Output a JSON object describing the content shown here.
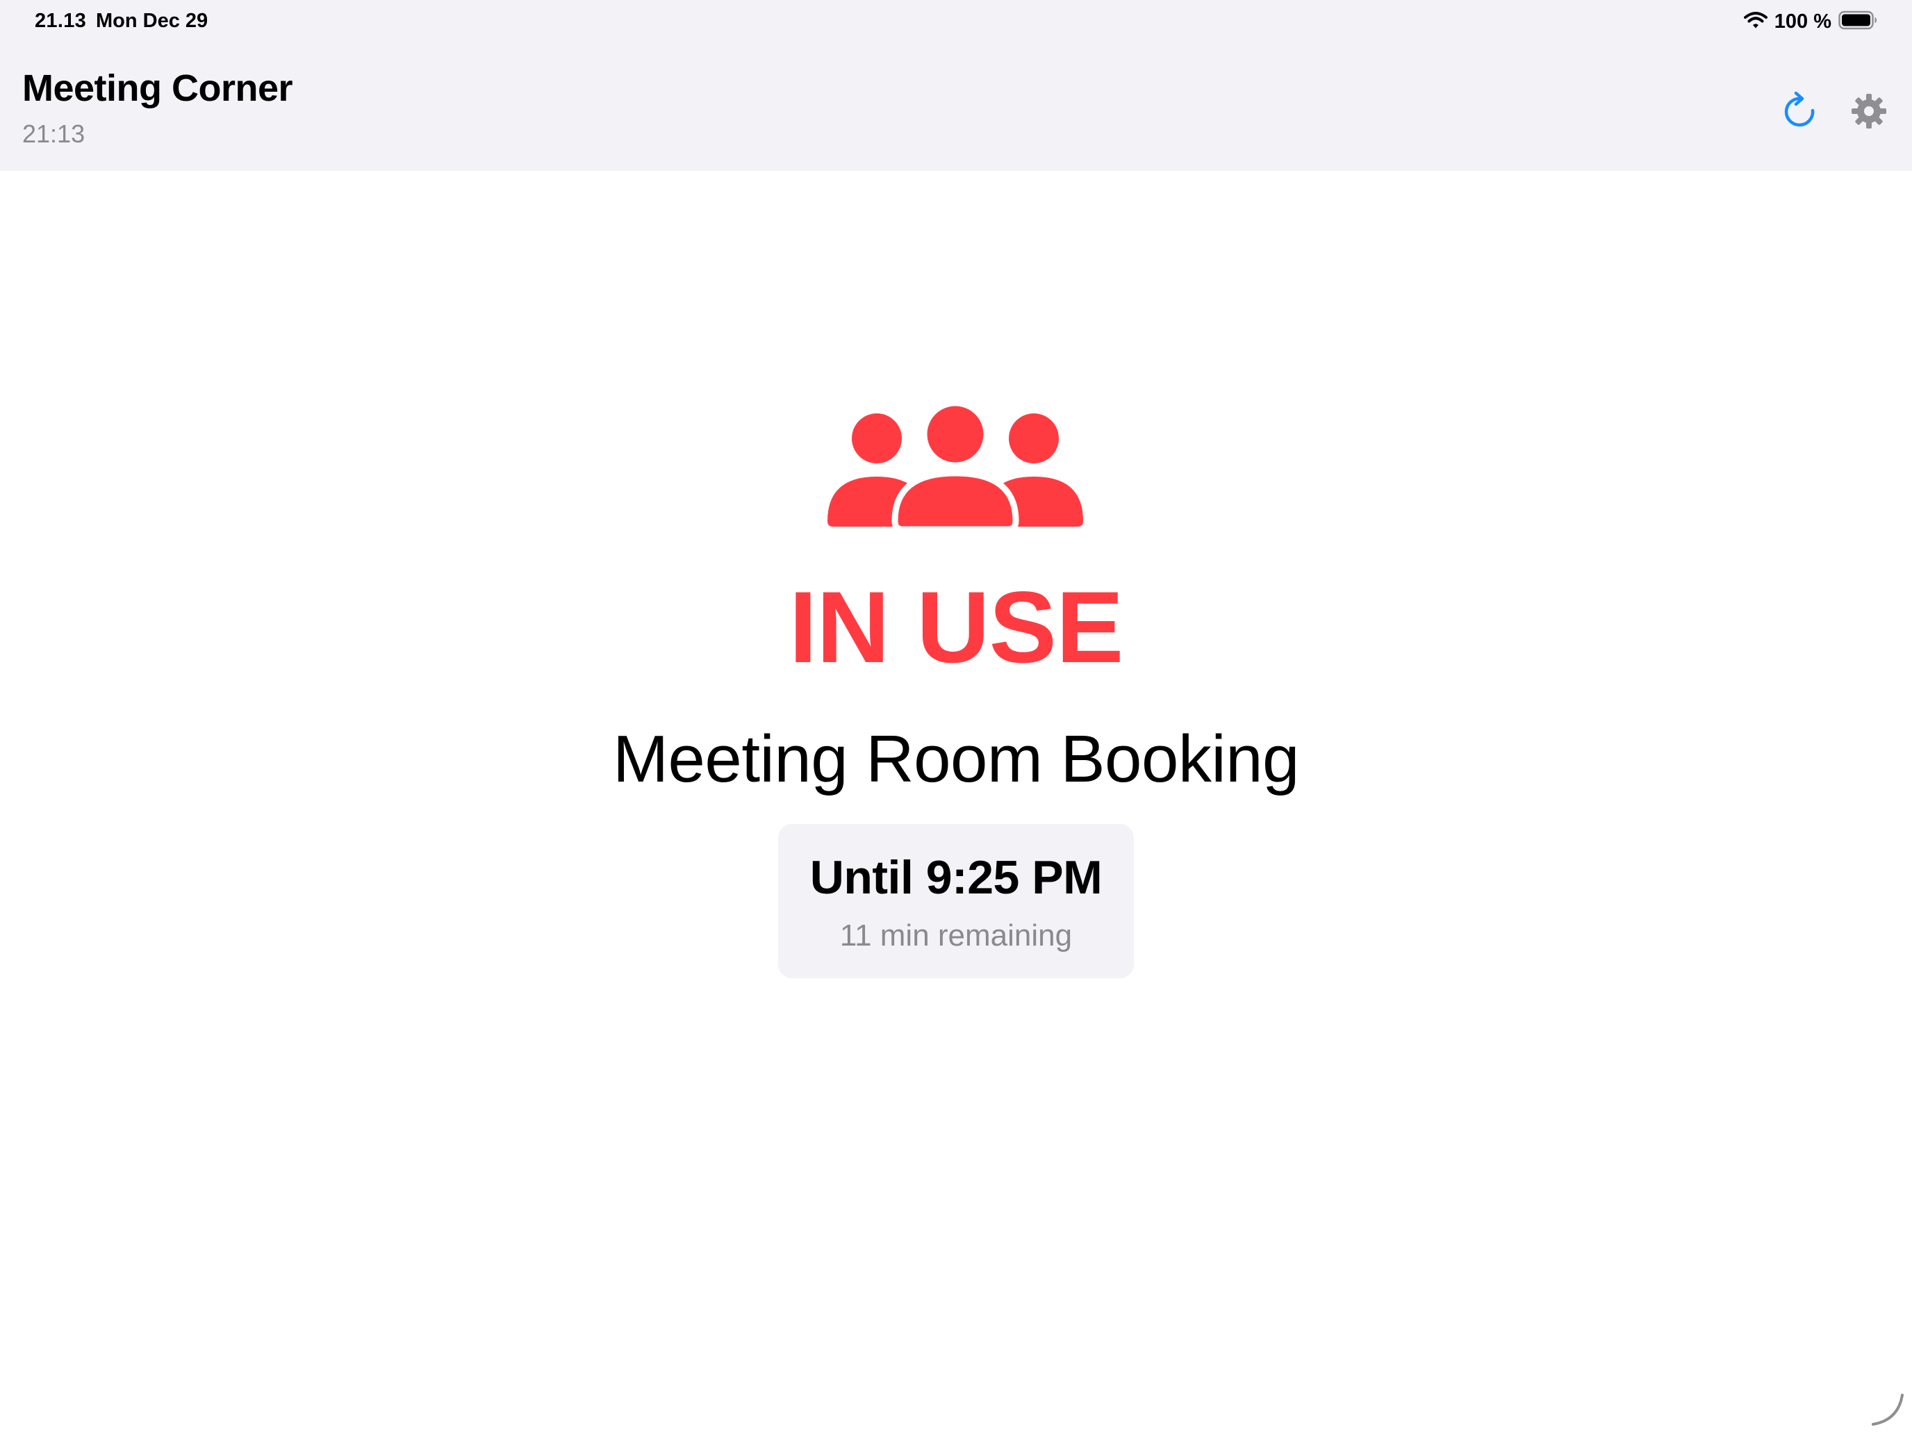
{
  "status_bar": {
    "time": "21.13",
    "date": "Mon Dec 29",
    "battery": "100 %",
    "wifi_icon": "wifi-icon",
    "battery_icon": "battery-icon"
  },
  "header": {
    "title": "Meeting Corner",
    "time": "21:13",
    "refresh_icon": "refresh-icon",
    "settings_icon": "gear-icon"
  },
  "room": {
    "status_icon": "people-group-icon",
    "status": "IN USE",
    "status_color": "#ff3b42",
    "meeting_title": "Meeting Room Booking",
    "until": "Until 9:25 PM",
    "remaining": "11 min remaining"
  },
  "colors": {
    "accent": "#1a8cff",
    "busy": "#ff3b42",
    "header_bg": "#f2f2f7",
    "secondary_text": "#8a8a8e"
  }
}
